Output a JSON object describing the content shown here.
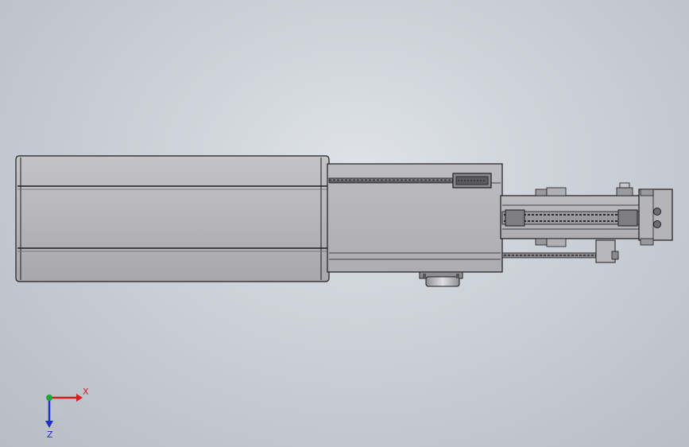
{
  "viewport": {
    "background_colors": [
      "#dfe3e9",
      "#b7bcc5"
    ]
  },
  "model": {
    "body_color": "#b6b6b8",
    "shade_color": "#9d9da1",
    "edge_color": "#1c1c1e",
    "chain_color": "#4a4a4e"
  },
  "triad": {
    "x_label": "X",
    "z_label": "Z",
    "x_color": "#d21f1f",
    "y_color": "#1fa83a",
    "z_color": "#1f2fc8"
  }
}
